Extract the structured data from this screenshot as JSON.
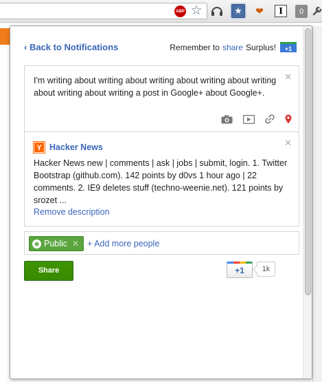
{
  "toolbar": {
    "abp_label": "ABP",
    "zero_badge": "0",
    "i_label": "I"
  },
  "header": {
    "back_label": "‹ Back to Notifications",
    "remember_prefix": "Remember to",
    "remember_link": "share",
    "remember_suffix": "Surplus!",
    "plus_badge": "+1"
  },
  "post": {
    "text": "I'm writing about writing about writing about writing about writing about writing about writing a post in Google+ about Google+.",
    "close": "✕",
    "tools": [
      "camera-icon",
      "video-icon",
      "link-icon",
      "location-pin-icon"
    ]
  },
  "link_preview": {
    "logo_letter": "Y",
    "title": "Hacker News",
    "description": "Hacker News new | comments | ask | jobs | submit, login. 1. Twitter Bootstrap (github.com). 142 points by d0vs 1 hour ago | 22 comments. 2. IE9 deletes stuff (techno-weenie.net). 121 points by srozet ...",
    "remove_label": "Remove description",
    "close": "✕"
  },
  "audience": {
    "chip_label": "Public",
    "chip_remove": "✕",
    "add_label": "+ Add more people"
  },
  "actions": {
    "share_label": "Share",
    "plusone_label": "+1",
    "plusone_count": "1k"
  },
  "colors": {
    "link": "#3a66b8",
    "share_green": "#3d9400",
    "public_green": "#5aa53e",
    "hn_orange": "#ff6600"
  }
}
